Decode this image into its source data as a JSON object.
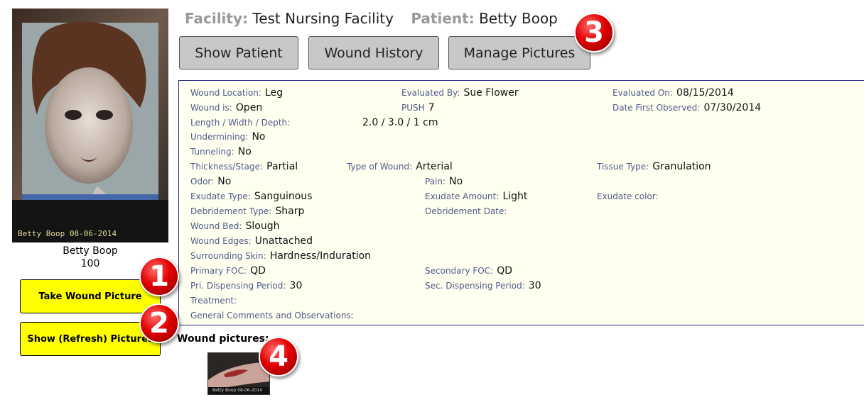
{
  "patient": {
    "photo_caption": "Betty Boop 08-06-2014",
    "name": "Betty Boop",
    "number": "100"
  },
  "actions": {
    "take_picture": "Take Wound Picture",
    "refresh_pictures": "Show (Refresh) Pictures"
  },
  "header": {
    "facility_label": "Facility:",
    "facility": "Test Nursing Facility",
    "patient_label": "Patient:",
    "patient": "Betty Boop"
  },
  "nav": {
    "show_patient": "Show Patient",
    "wound_history": "Wound History",
    "manage_pictures": "Manage Pictures"
  },
  "details": {
    "wound_location_label": "Wound Location:",
    "wound_location": "Leg",
    "evaluated_by_label": "Evaluated By:",
    "evaluated_by": "Sue Flower",
    "evaluated_on_label": "Evaluated On:",
    "evaluated_on": "08/15/2014",
    "wound_is_label": "Wound is:",
    "wound_is": "Open",
    "push_label": "PUSH",
    "push": "7",
    "first_observed_label": "Date First Observed:",
    "first_observed": "07/30/2014",
    "lwd_label": "Length / Width / Depth:",
    "lwd": "2.0 / 3.0 / 1 cm",
    "undermining_label": "Undermining:",
    "undermining": "No",
    "tunneling_label": "Tunneling:",
    "tunneling": "No",
    "thickness_label": "Thickness/Stage:",
    "thickness": "Partial",
    "type_label": "Type of Wound:",
    "type": "Arterial",
    "tissue_label": "Tissue Type:",
    "tissue": "Granulation",
    "odor_label": "Odor:",
    "odor": "No",
    "pain_label": "Pain:",
    "pain": "No",
    "exudate_type_label": "Exudate Type:",
    "exudate_type": "Sanguinous",
    "exudate_amount_label": "Exudate Amount:",
    "exudate_amount": "Light",
    "exudate_color_label": "Exudate color:",
    "exudate_color": "",
    "debridement_type_label": "Debridement Type:",
    "debridement_type": "Sharp",
    "debridement_date_label": "Debridement Date:",
    "debridement_date": "",
    "wound_bed_label": "Wound Bed:",
    "wound_bed": "Slough",
    "wound_edges_label": "Wound Edges:",
    "wound_edges": "Unattached",
    "surrounding_label": "Surrounding Skin:",
    "surrounding": "Hardness/Induration",
    "primary_foc_label": "Primary FOC:",
    "primary_foc": "QD",
    "secondary_foc_label": "Secondary FOC:",
    "secondary_foc": "QD",
    "pri_period_label": "Pri. Dispensing Period:",
    "pri_period": "30",
    "sec_period_label": "Sec. Dispensing Period:",
    "sec_period": "30",
    "treatment_label": "Treatment:",
    "treatment": "",
    "comments_label": "General Comments and Observations:",
    "comments": ""
  },
  "wound_pictures": {
    "label": "Wound pictures:",
    "thumb_caption": "Betty Boop 08-06-2014"
  },
  "badges": [
    "1",
    "2",
    "3",
    "4"
  ],
  "colors": {
    "action_button": "#ffff00",
    "nav_button": "#c8c8c8",
    "panel_background": "#fffff0",
    "panel_border": "#2b2b8c",
    "field_label": "#4f5a8a",
    "badge": "#e10000"
  }
}
